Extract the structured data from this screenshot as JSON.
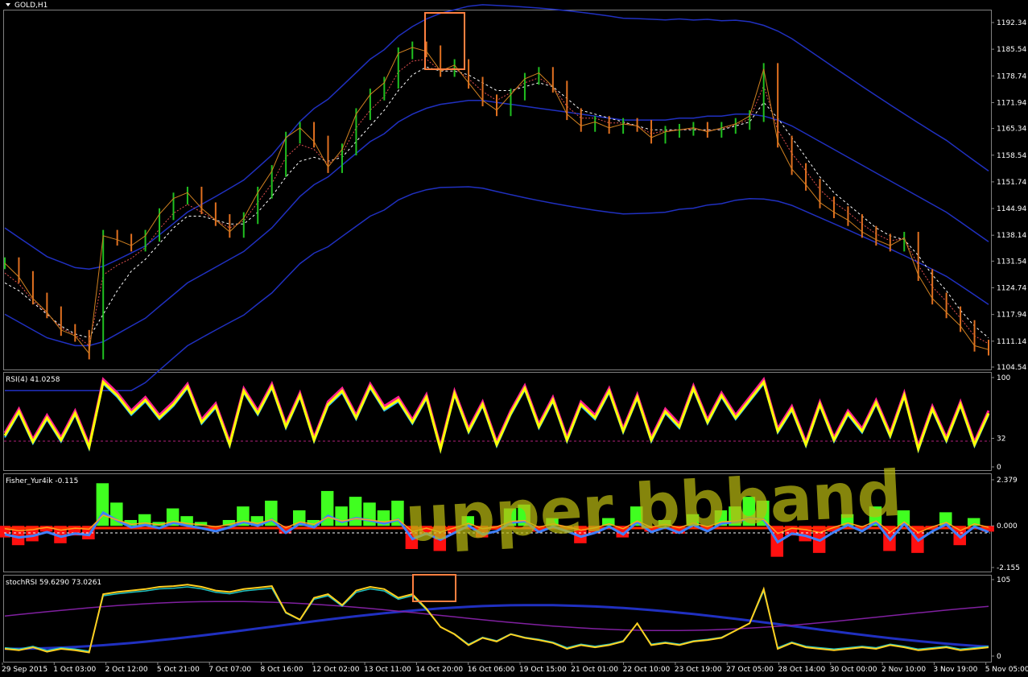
{
  "chart_data": [
    {
      "type": "line",
      "subtype": "candlestick",
      "title": "GOLD,H1",
      "yticks": [
        1192.34,
        1185.54,
        1178.74,
        1171.94,
        1165.34,
        1158.54,
        1151.74,
        1144.94,
        1138.14,
        1131.54,
        1124.74,
        1117.94,
        1111.14,
        1104.54
      ],
      "ylim": [
        1104.54,
        1192.34
      ],
      "xlabels": [
        "29 Sep 2015",
        "1 Oct 03:00",
        "2 Oct 12:00",
        "5 Oct 21:00",
        "7 Oct 07:00",
        "8 Oct 16:00",
        "12 Oct 02:00",
        "13 Oct 11:00",
        "14 Oct 20:00",
        "16 Oct 06:00",
        "19 Oct 15:00",
        "21 Oct 01:00",
        "22 Oct 10:00",
        "23 Oct 19:00",
        "27 Oct 05:00",
        "28 Oct 14:00",
        "30 Oct 00:00",
        "2 Nov 10:00",
        "3 Nov 19:00",
        "5 Nov 05:00"
      ],
      "series": [
        {
          "values": [
            1131.0,
            1127.5,
            1122.0,
            1118.5,
            1114.0,
            1112.5,
            1108.0,
            1138.0,
            1137.0,
            1135.5,
            1138.0,
            1143.5,
            1147.5,
            1149.0,
            1145.0,
            1142.0,
            1139.0,
            1142.5,
            1149.0,
            1154.5,
            1163.0,
            1165.5,
            1162.0,
            1155.5,
            1160.0,
            1169.0,
            1174.0,
            1177.0,
            1184.5,
            1186.0,
            1185.0,
            1180.0,
            1181.5,
            1177.0,
            1172.5,
            1170.0,
            1174.0,
            1178.0,
            1179.5,
            1176.0,
            1169.0,
            1166.0,
            1167.0,
            1165.5,
            1166.5,
            1166.0,
            1163.0,
            1164.5,
            1165.0,
            1165.5,
            1164.5,
            1165.5,
            1166.5,
            1168.5,
            1180.5,
            1162.0,
            1155.0,
            1151.0,
            1146.5,
            1144.0,
            1142.0,
            1139.0,
            1137.0,
            1135.5,
            1137.5,
            1128.0,
            1122.0,
            1118.5,
            1115.0,
            1110.0,
            1109.0
          ]
        },
        {
          "values": [
            1126.0,
            1124.0,
            1121.0,
            1118.0,
            1115.0,
            1113.0,
            1112.0,
            1118.0,
            1124.0,
            1129.0,
            1132.0,
            1136.0,
            1140.0,
            1143.0,
            1143.0,
            1142.0,
            1141.0,
            1141.0,
            1144.0,
            1148.0,
            1153.0,
            1157.0,
            1158.0,
            1157.0,
            1158.0,
            1162.0,
            1166.0,
            1170.0,
            1175.0,
            1179.0,
            1181.0,
            1180.0,
            1180.0,
            1179.0,
            1177.0,
            1175.0,
            1175.0,
            1176.0,
            1177.0,
            1176.0,
            1173.0,
            1170.0,
            1169.0,
            1168.0,
            1167.0,
            1166.0,
            1165.0,
            1165.0,
            1165.0,
            1165.0,
            1165.0,
            1165.0,
            1166.0,
            1167.0,
            1172.0,
            1168.0,
            1163.0,
            1158.0,
            1153.0,
            1149.0,
            1146.0,
            1143.0,
            1140.0,
            1138.0,
            1137.0,
            1133.0,
            1128.0,
            1124.0,
            1119.0,
            1115.0,
            1112.0
          ]
        },
        {
          "values": [
            1118.0,
            1116.0,
            1114.0,
            1112.0,
            1111.0,
            1110.0,
            1110.0,
            1111.0,
            1113.0,
            1115.0,
            1117.0,
            1120.0,
            1123.0,
            1126.0,
            1128.0,
            1130.0,
            1132.0,
            1134.0,
            1137.0,
            1140.0,
            1144.0,
            1148.0,
            1151.0,
            1153.0,
            1156.0,
            1159.0,
            1162.0,
            1164.0,
            1167.0,
            1169.0,
            1170.5,
            1171.5,
            1172.0,
            1172.5,
            1172.5,
            1172.0,
            1171.5,
            1171.0,
            1170.5,
            1170.0,
            1169.5,
            1169.0,
            1168.5,
            1168.0,
            1167.5,
            1167.5,
            1167.5,
            1167.5,
            1168.0,
            1168.0,
            1168.5,
            1168.5,
            1169.0,
            1169.0,
            1168.5,
            1167.5,
            1166.0,
            1164.0,
            1162.0,
            1160.0,
            1158.0,
            1156.0,
            1154.0,
            1152.0,
            1150.0,
            1148.0,
            1146.0,
            1144.0,
            1141.5,
            1139.0,
            1136.5
          ]
        }
      ]
    },
    {
      "type": "line",
      "title": "RSI(4) 41.0258",
      "yticks": [
        100,
        32,
        0
      ],
      "ylim": [
        0,
        100
      ],
      "series": [
        {
          "values": [
            35,
            62,
            28,
            55,
            30,
            60,
            22,
            95,
            80,
            60,
            75,
            55,
            70,
            90,
            50,
            68,
            25,
            85,
            60,
            90,
            45,
            80,
            30,
            70,
            85,
            55,
            90,
            65,
            75,
            50,
            78,
            20,
            82,
            40,
            70,
            25,
            60,
            88,
            45,
            75,
            30,
            70,
            55,
            85,
            40,
            78,
            30,
            62,
            45,
            88,
            50,
            80,
            55,
            75,
            95,
            40,
            65,
            25,
            70,
            30,
            60,
            40,
            72,
            35,
            80,
            20,
            65,
            30,
            70,
            25,
            60
          ]
        }
      ]
    },
    {
      "type": "bar",
      "title": "Fisher_Yur4ik -0.115",
      "yticks": [
        2.379,
        0.0,
        -2.155
      ],
      "ylim": [
        -2.155,
        2.379
      ],
      "series": [
        {
          "values": [
            -0.6,
            -1.0,
            -0.8,
            -0.3,
            -0.9,
            -0.5,
            -0.7,
            2.2,
            1.2,
            0.3,
            0.6,
            0.2,
            0.9,
            0.5,
            0.2,
            -0.2,
            0.3,
            1.0,
            0.5,
            1.3,
            -0.4,
            0.8,
            0.3,
            1.8,
            1.0,
            1.5,
            1.2,
            0.8,
            1.3,
            -1.2,
            -0.5,
            -1.3,
            -0.4,
            0.5,
            -0.6,
            -0.2,
            0.9,
            1.1,
            -0.3,
            0.4,
            -0.2,
            -0.9,
            -0.4,
            0.4,
            -0.6,
            1.0,
            -0.3,
            0.3,
            -0.4,
            0.6,
            -0.2,
            0.8,
            1.0,
            1.5,
            1.3,
            -1.6,
            -0.5,
            -0.8,
            -1.4,
            -0.3,
            0.6,
            -0.2,
            1.0,
            -1.3,
            0.8,
            -1.4,
            -0.2,
            0.7,
            -1.0,
            0.4,
            -0.3
          ]
        }
      ]
    },
    {
      "type": "line",
      "title": "stochRSI 59.6290 73.0261",
      "yticks": [
        105,
        0
      ],
      "ylim": [
        0,
        105
      ],
      "series": [
        {
          "values": [
            10,
            8,
            12,
            6,
            10,
            8,
            5,
            85,
            88,
            90,
            92,
            95,
            96,
            98,
            95,
            90,
            88,
            92,
            94,
            96,
            60,
            50,
            80,
            85,
            70,
            90,
            95,
            92,
            80,
            85,
            65,
            40,
            30,
            15,
            25,
            20,
            30,
            25,
            22,
            18,
            10,
            15,
            12,
            15,
            20,
            45,
            15,
            18,
            15,
            20,
            22,
            25,
            35,
            45,
            92,
            10,
            18,
            12,
            10,
            8,
            10,
            12,
            10,
            15,
            12,
            8,
            10,
            12,
            8,
            10,
            12
          ]
        }
      ]
    }
  ],
  "watermark": "upper bbband"
}
